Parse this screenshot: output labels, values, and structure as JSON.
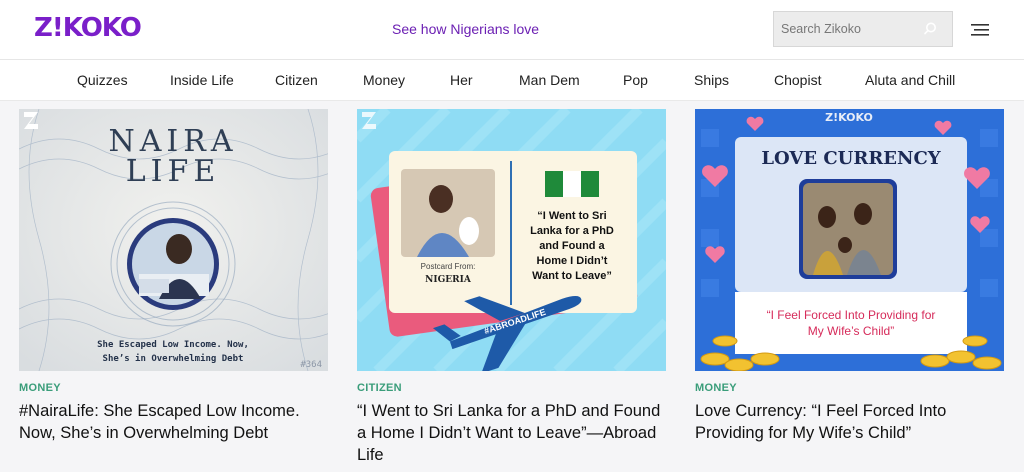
{
  "header": {
    "logo": "Z!KOKO",
    "tagline": "See how Nigerians love",
    "search_placeholder": "Search Zikoko"
  },
  "nav": [
    "Quizzes",
    "Inside Life",
    "Citizen",
    "Money",
    "Her",
    "Man Dem",
    "Pop",
    "Ships",
    "Chopist",
    "Aluta and Chill"
  ],
  "cards": [
    {
      "category": "MONEY",
      "title": "#NairaLife: She Escaped Low Income. Now, She’s in Overwhelming Debt",
      "image": {
        "heading_1": "NAIRA",
        "heading_2": "LIFE",
        "caption_1": "She Escaped Low Income. Now,",
        "caption_2": "She’s in Overwhelming Debt",
        "issue": "#364"
      }
    },
    {
      "category": "CITIZEN",
      "title": "“I Went to Sri Lanka for a PhD and Found a Home I Didn’t Want to Leave”—Abroad Life",
      "image": {
        "postcard_from": "Postcard From:",
        "country": "NIGERIA",
        "quote_lines": [
          "“I Went to Sri",
          "Lanka for a PhD",
          "and Found a",
          "Home I Didn’t",
          "Want to Leave”"
        ],
        "plane_text": "#ABROADLIFE"
      }
    },
    {
      "category": "MONEY",
      "title": "Love Currency: “I Feel Forced Into Providing for My Wife’s Child”",
      "image": {
        "brand": "Z!KOKO",
        "heading": "LOVE CURRENCY",
        "quote_1": "“I Feel Forced Into Providing for",
        "quote_2": "My Wife’s Child”"
      }
    }
  ]
}
